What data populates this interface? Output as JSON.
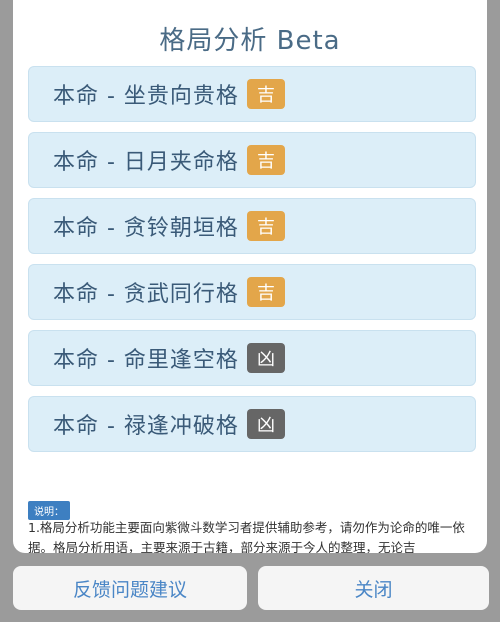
{
  "modal": {
    "title": "格局分析 Beta",
    "items": [
      {
        "label": "本命 - 坐贵向贵格",
        "badge": "吉",
        "type": "good"
      },
      {
        "label": "本命 - 日月夹命格",
        "badge": "吉",
        "type": "good"
      },
      {
        "label": "本命 - 贪铃朝垣格",
        "badge": "吉",
        "type": "good"
      },
      {
        "label": "本命 - 贪武同行格",
        "badge": "吉",
        "type": "good"
      },
      {
        "label": "本命 - 命里逢空格",
        "badge": "凶",
        "type": "bad"
      },
      {
        "label": "本命 - 禄逢冲破格",
        "badge": "凶",
        "type": "bad"
      }
    ],
    "note_tag": "说明：",
    "note_text": "1.格局分析功能主要面向紫微斗数学习者提供辅助参考，请勿作为论命的唯一依据。格局分析用语，主要来源于古籍，部分来源于今人的整理，无论吉"
  },
  "buttons": {
    "feedback": "反馈问题建议",
    "close": "关闭"
  },
  "colors": {
    "good_badge": "#e3a64a",
    "bad_badge": "#666666",
    "item_bg": "#dceef8",
    "accent": "#4a86c6"
  }
}
